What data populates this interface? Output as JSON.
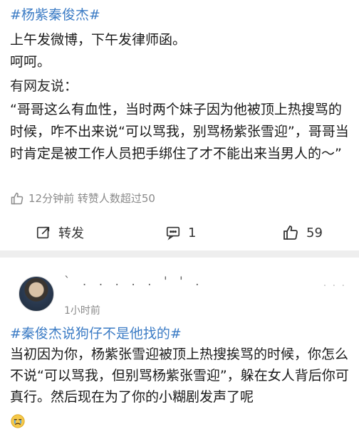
{
  "post1": {
    "hashtag": "#杨紫秦俊杰#",
    "line1": "上午发微博，下午发律师函。",
    "line2": "呵呵。",
    "line3": "有网友说：",
    "quote": "“哥哥这么有血性，当时两个妹子因为他被顶上热搜骂的时候，咋不出来说“可以骂我，别骂杨紫张雪迎”，哥哥当时肯定是被工作人员把手绑住了才不能出来当男人的～”",
    "meta_text": "12分钟前 转赞人数超过50",
    "actions": {
      "repost_label": "转发",
      "comment_count": "1",
      "like_count": "59"
    }
  },
  "post2": {
    "username": "`  . . . . .  '  '  .",
    "time": "1小时前",
    "hashtag": "#秦俊杰说狗仔不是他找的#",
    "body": "当初因为你，杨紫张雪迎被顶上热搜挨骂的时候，你怎么不说“可以骂我，但别骂杨紫张雪迎”，躲在女人背后你可真行。然后现在为了你的小糊剧发声了呢",
    "more_icon": "more-dots-icon"
  },
  "colors": {
    "link": "#3c7cc5",
    "meta": "#8a8a8a",
    "separator": "#eeeeee"
  }
}
